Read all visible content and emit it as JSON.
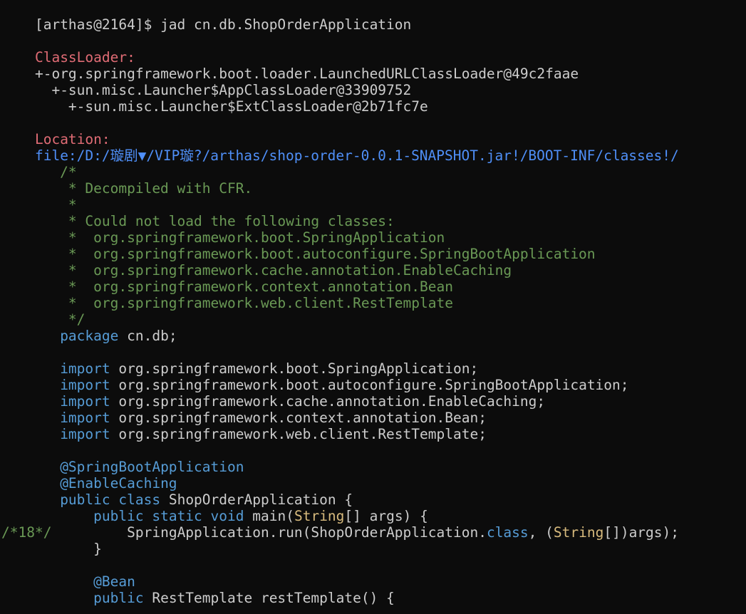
{
  "colors": {
    "background": "#0c0c0c",
    "text": "#cccccc",
    "keyword": "#569cd6",
    "type": "#d7ba7d",
    "comment": "#6a9955",
    "label": "#e06c75",
    "location": "#4f8ff7"
  },
  "prompt": {
    "text": "[arthas@2164]$ jad cn.db.ShopOrderApplication"
  },
  "classloader": {
    "label": "ClassLoader:",
    "tree": [
      "+-org.springframework.boot.loader.LaunchedURLClassLoader@49c2faae",
      "  +-sun.misc.Launcher$AppClassLoader@33909752",
      "    +-sun.misc.Launcher$ExtClassLoader@2b71fc7e"
    ]
  },
  "location": {
    "label": "Location:",
    "path": "file:/D:/璇剧▼/VIP璇?/arthas/shop-order-0.0.1-SNAPSHOT.jar!/BOOT-INF/classes!/"
  },
  "comment_block": [
    "       /*",
    "        * Decompiled with CFR.",
    "        *",
    "        * Could not load the following classes:",
    "        *  org.springframework.boot.SpringApplication",
    "        *  org.springframework.boot.autoconfigure.SpringBootApplication",
    "        *  org.springframework.cache.annotation.EnableCaching",
    "        *  org.springframework.context.annotation.Bean",
    "        *  org.springframework.web.client.RestTemplate",
    "        */"
  ],
  "code": {
    "indent": "       ",
    "indent2": "           ",
    "package_kw": "package",
    "package_name": " cn.db;",
    "import_kw": "import",
    "imports": [
      " org.springframework.boot.SpringApplication;",
      " org.springframework.boot.autoconfigure.SpringBootApplication;",
      " org.springframework.cache.annotation.EnableCaching;",
      " org.springframework.context.annotation.Bean;",
      " org.springframework.web.client.RestTemplate;"
    ],
    "annotations": [
      "@SpringBootApplication",
      "@EnableCaching"
    ],
    "class_line": {
      "public_kw": "public",
      "class_kw": "class",
      "name": " ShopOrderApplication {"
    },
    "main_line": {
      "public_kw": "public",
      "static_kw": "static",
      "void_kw": "void",
      "name": " main(",
      "type": "String",
      "rest": "[] args) {"
    },
    "run_line": {
      "line_marker": "/*18*/",
      "spacing": "         ",
      "call": "SpringApplication.run(ShopOrderApplication.",
      "class_kw": "class",
      "sep": ", (",
      "type": "String",
      "rest": "[])args);"
    },
    "close_brace": "}",
    "bean_annotation": "@Bean",
    "rest_line": {
      "public_kw": "public",
      "rest": " RestTemplate restTemplate() {"
    }
  }
}
